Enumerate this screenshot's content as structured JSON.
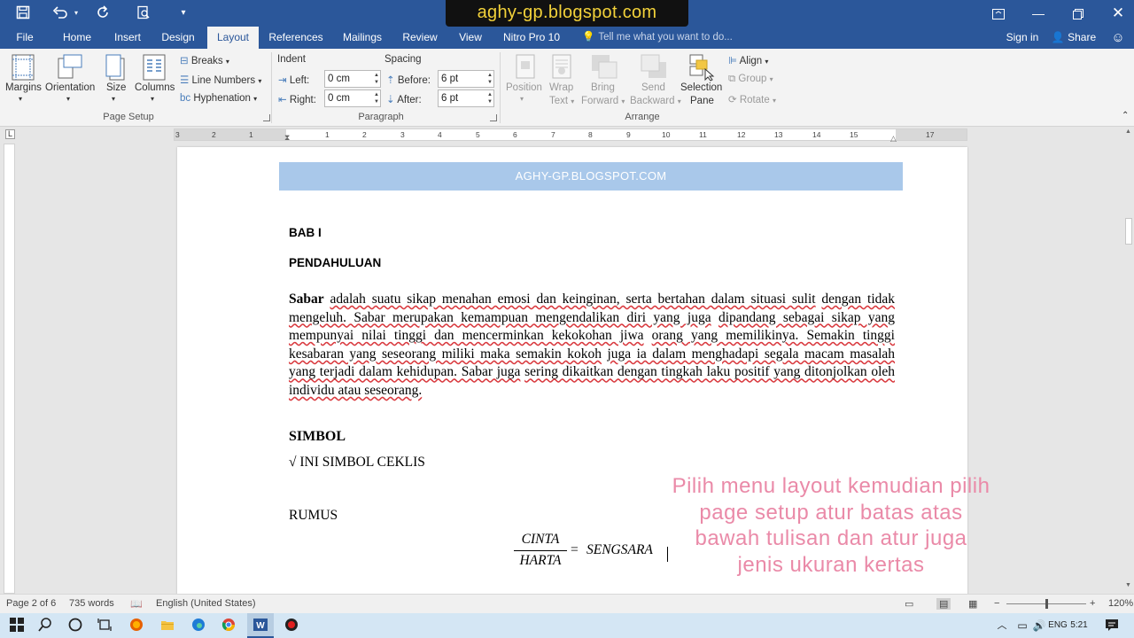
{
  "watermark": "aghy-gp.blogspot.com",
  "quick_access": {
    "save_icon": "save-icon",
    "undo_icon": "undo-icon",
    "redo_icon": "redo-icon",
    "print_preview_icon": "print-preview-icon",
    "customize_icon": "customize-qat-icon"
  },
  "menu": {
    "tabs": [
      "File",
      "Home",
      "Insert",
      "Design",
      "Layout",
      "References",
      "Mailings",
      "Review",
      "View",
      "Nitro Pro 10"
    ],
    "active_tab": "Layout",
    "tell_me": "Tell me what you want to do...",
    "sign_in": "Sign in",
    "share": "Share"
  },
  "ribbon": {
    "page_setup": {
      "group_label": "Page Setup",
      "margins": "Margins",
      "orientation": "Orientation",
      "size": "Size",
      "columns": "Columns",
      "breaks": "Breaks",
      "line_numbers": "Line Numbers",
      "hyphenation": "Hyphenation"
    },
    "paragraph": {
      "group_label": "Paragraph",
      "indent_label": "Indent",
      "spacing_label": "Spacing",
      "left_label": "Left:",
      "left_value": "0 cm",
      "right_label": "Right:",
      "right_value": "0 cm",
      "before_label": "Before:",
      "before_value": "6 pt",
      "after_label": "After:",
      "after_value": "6 pt"
    },
    "arrange": {
      "group_label": "Arrange",
      "position": "Position",
      "wrap_text_1": "Wrap",
      "wrap_text_2": "Text",
      "bring_forward_1": "Bring",
      "bring_forward_2": "Forward",
      "send_backward_1": "Send",
      "send_backward_2": "Backward",
      "selection_pane_1": "Selection",
      "selection_pane_2": "Pane",
      "align": "Align",
      "group": "Group",
      "rotate": "Rotate"
    }
  },
  "ruler": {
    "numbers": [
      "3",
      "2",
      "1",
      "1",
      "2",
      "3",
      "4",
      "5",
      "6",
      "7",
      "8",
      "9",
      "10",
      "11",
      "12",
      "13",
      "14",
      "15",
      "17"
    ]
  },
  "document": {
    "header_band": "AGHY-GP.BLOGSPOT.COM",
    "bab": "BAB I",
    "pendahuluan": "PENDAHULUAN",
    "para_lead": "Sabar",
    "para_lines": [
      "adalah  suatu sikap menahan emosi dan keinginan,  serta  bertahan  dalam  situasi  sulit",
      "dengan   tidak   mengeluh. Sabar   merupakan   kemampuan   mengendalikan   diri   yang   juga",
      "dipandang  sebagai  sikap  yang  mempunyai  nilai  tinggi  dan  mencerminkan  kekokohan  jiwa",
      "orang yang memilikinya. Semakin tinggi kesabaran yang seseorang miliki maka semakin kokoh",
      "juga  ia  dalam  menghadapi  segala  macam  masalah  yang  terjadi  dalam  kehidupan. Sabar  juga",
      "sering dikaitkan dengan tingkah laku positif yang ditonjolkan oleh individu atau seseorang."
    ],
    "simbol_heading": "SIMBOL",
    "simbol_line": "√ INI SIMBOL CEKLIS",
    "rumus_heading": "RUMUS",
    "formula_numerator": "CINTA",
    "formula_denominator": "HARTA",
    "formula_equals": "=",
    "formula_result": "SENGSARA"
  },
  "overlay_note": [
    "Pilih menu layout kemudian pilih",
    "page setup atur batas atas",
    "bawah tulisan  dan atur juga",
    "jenis ukuran kertas"
  ],
  "status": {
    "page": "Page 2 of 6",
    "words": "735 words",
    "language": "English (United States)",
    "zoom": "120%"
  },
  "taskbar": {
    "language": "ENG",
    "time": "5:21"
  },
  "colors": {
    "title_blue": "#2b579a",
    "header_band": "#a9c8ea",
    "note_pink": "#ea8aa8"
  }
}
